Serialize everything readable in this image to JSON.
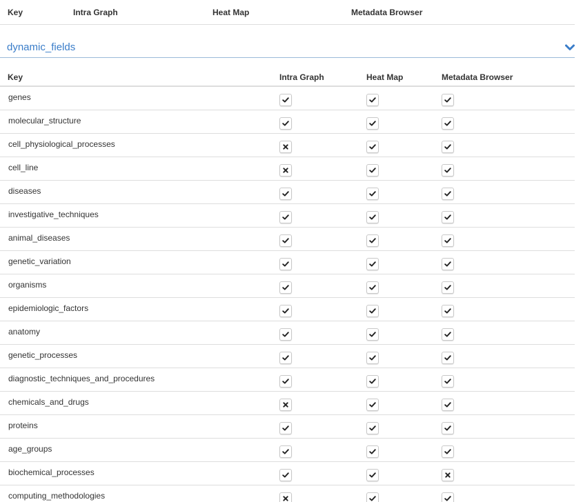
{
  "columns": {
    "key": "Key",
    "intra_graph": "Intra Graph",
    "heat_map": "Heat Map",
    "metadata_browser": "Metadata Browser"
  },
  "section": {
    "title": "dynamic_fields",
    "icon": "chevron-down-icon",
    "accent_color": "#3a7dc9"
  },
  "rows": [
    {
      "key": "genes",
      "intra_graph": true,
      "heat_map": true,
      "metadata_browser": true
    },
    {
      "key": "molecular_structure",
      "intra_graph": true,
      "heat_map": true,
      "metadata_browser": true
    },
    {
      "key": "cell_physiological_processes",
      "intra_graph": false,
      "heat_map": true,
      "metadata_browser": true
    },
    {
      "key": "cell_line",
      "intra_graph": false,
      "heat_map": true,
      "metadata_browser": true
    },
    {
      "key": "diseases",
      "intra_graph": true,
      "heat_map": true,
      "metadata_browser": true
    },
    {
      "key": "investigative_techniques",
      "intra_graph": true,
      "heat_map": true,
      "metadata_browser": true
    },
    {
      "key": "animal_diseases",
      "intra_graph": true,
      "heat_map": true,
      "metadata_browser": true
    },
    {
      "key": "genetic_variation",
      "intra_graph": true,
      "heat_map": true,
      "metadata_browser": true
    },
    {
      "key": "organisms",
      "intra_graph": true,
      "heat_map": true,
      "metadata_browser": true
    },
    {
      "key": "epidemiologic_factors",
      "intra_graph": true,
      "heat_map": true,
      "metadata_browser": true
    },
    {
      "key": "anatomy",
      "intra_graph": true,
      "heat_map": true,
      "metadata_browser": true
    },
    {
      "key": "genetic_processes",
      "intra_graph": true,
      "heat_map": true,
      "metadata_browser": true
    },
    {
      "key": "diagnostic_techniques_and_procedures",
      "intra_graph": true,
      "heat_map": true,
      "metadata_browser": true
    },
    {
      "key": "chemicals_and_drugs",
      "intra_graph": false,
      "heat_map": true,
      "metadata_browser": true
    },
    {
      "key": "proteins",
      "intra_graph": true,
      "heat_map": true,
      "metadata_browser": true
    },
    {
      "key": "age_groups",
      "intra_graph": true,
      "heat_map": true,
      "metadata_browser": true
    },
    {
      "key": "biochemical_processes",
      "intra_graph": true,
      "heat_map": true,
      "metadata_browser": false
    },
    {
      "key": "computing_methodologies",
      "intra_graph": false,
      "heat_map": true,
      "metadata_browser": true
    }
  ]
}
